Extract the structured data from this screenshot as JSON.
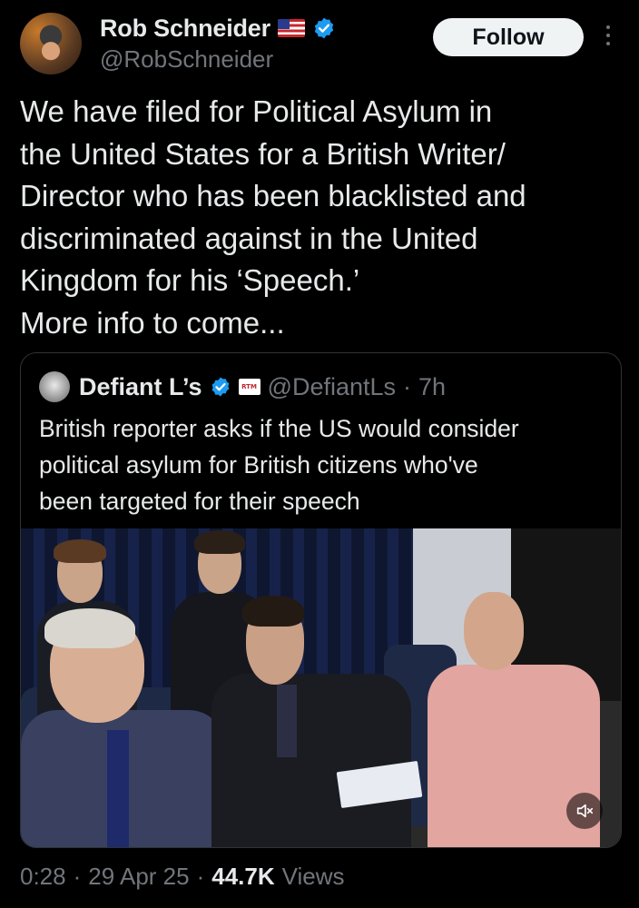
{
  "author": {
    "display_name": "Rob Schneider",
    "handle": "@RobSchneider",
    "flag_icon": "us-flag-icon",
    "verified_icon": "verified-badge-icon",
    "verified_color": "#1d9bf0"
  },
  "follow_label": "Follow",
  "tweet_text": "We have filed for  Political Asylum in\nthe United States for a British Writer/\nDirector who has been blacklisted and\ndiscriminated against in the United\nKingdom for his ‘Speech.’\nMore info to come...",
  "quote": {
    "display_name": "Defiant L’s",
    "affiliate_badge": "RTM",
    "handle": "@DefiantLs",
    "separator": "·",
    "time": "7h",
    "text": "British reporter asks if the US would consider\npolitical asylum for British citizens who've\nbeen targeted for their speech",
    "media": {
      "type": "video",
      "mute_icon": "muted-speaker-icon"
    }
  },
  "meta": {
    "duration": "0:28",
    "sep1": "·",
    "date": "29 Apr 25",
    "sep2": "·",
    "views_count": "44.7K",
    "views_label": "Views"
  }
}
